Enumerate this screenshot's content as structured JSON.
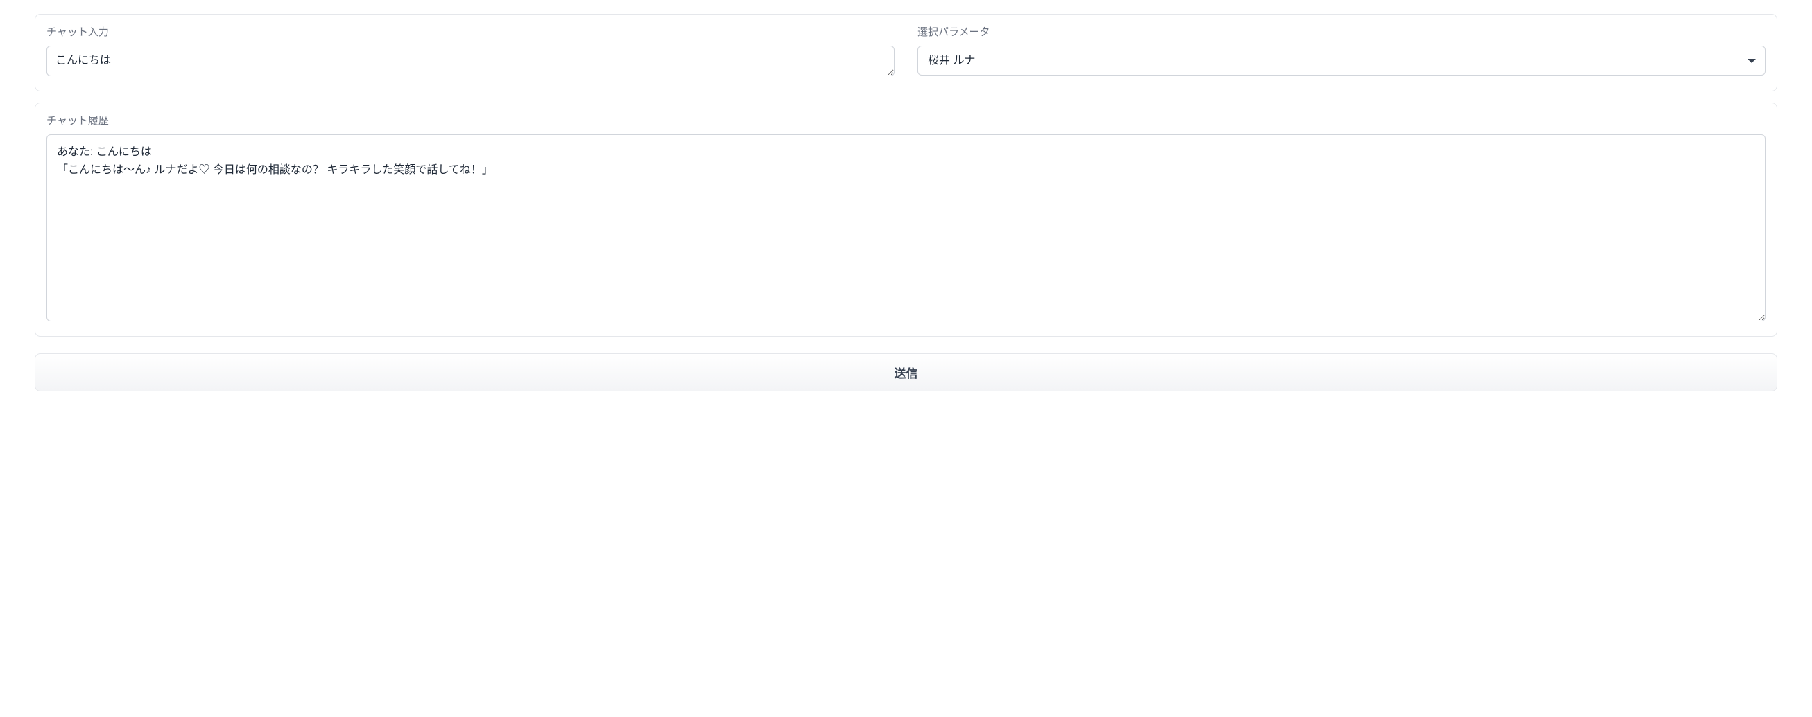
{
  "chat_input": {
    "label": "チャット入力",
    "value": "こんにちは"
  },
  "parameter_select": {
    "label": "選択パラメータ",
    "selected": "桜井 ルナ"
  },
  "chat_history": {
    "label": "チャット履歴",
    "content": "あなた: こんにちは\n「こんにちは〜ん♪ ルナだよ♡ 今日は何の相談なの？ キラキラした笑顔で話してね！」"
  },
  "submit_button": {
    "label": "送信"
  }
}
